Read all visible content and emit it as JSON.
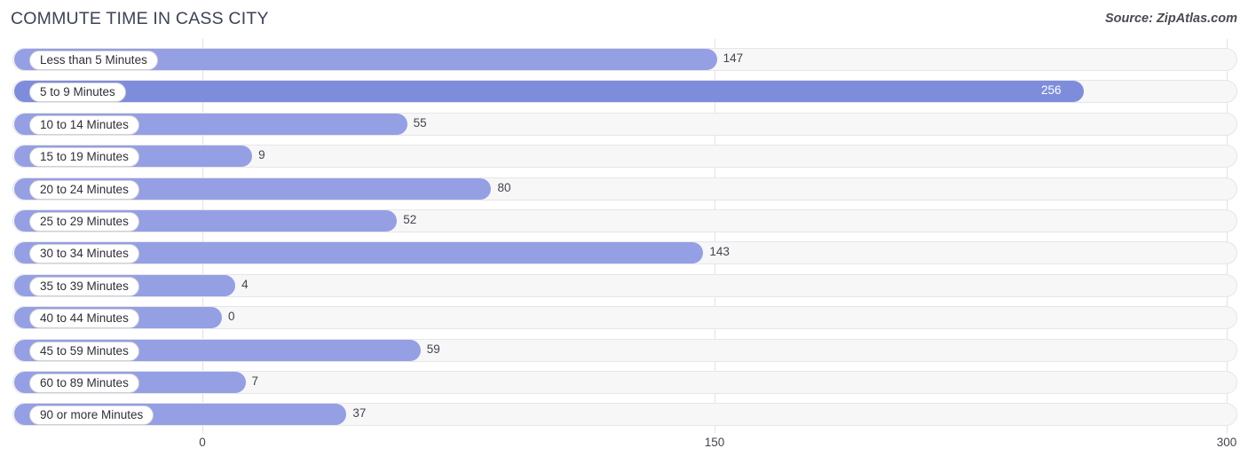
{
  "header": {
    "title": "COMMUTE TIME IN CASS CITY",
    "source": "Source: ZipAtlas.com"
  },
  "colors": {
    "bar_light": "#959fe3",
    "bar_dark": "#7e8ddb",
    "track_fill": "#f7f7f8",
    "track_border": "#e6e6e9",
    "gridline": "#e3e3e6",
    "label_text": "#2f2f39",
    "value_text": "#44444f",
    "value_text_inside": "#ffffff"
  },
  "chart_data": {
    "type": "bar",
    "orientation": "horizontal",
    "title": "COMMUTE TIME IN CASS CITY",
    "source": "Source: ZipAtlas.com",
    "xlabel": "",
    "ylabel": "",
    "xlim": [
      0,
      300
    ],
    "xticks": [
      0,
      150,
      300
    ],
    "xtick_labels": [
      "0",
      "150",
      "300"
    ],
    "grid": true,
    "legend": false,
    "categories": [
      "Less than 5 Minutes",
      "5 to 9 Minutes",
      "10 to 14 Minutes",
      "15 to 19 Minutes",
      "20 to 24 Minutes",
      "25 to 29 Minutes",
      "30 to 34 Minutes",
      "35 to 39 Minutes",
      "40 to 44 Minutes",
      "45 to 59 Minutes",
      "60 to 89 Minutes",
      "90 or more Minutes"
    ],
    "values": [
      147,
      256,
      55,
      9,
      80,
      52,
      143,
      4,
      0,
      59,
      7,
      37
    ],
    "value_labels": [
      "147",
      "256",
      "55",
      "9",
      "80",
      "52",
      "143",
      "4",
      "0",
      "59",
      "7",
      "37"
    ],
    "highlight_index": 1
  }
}
